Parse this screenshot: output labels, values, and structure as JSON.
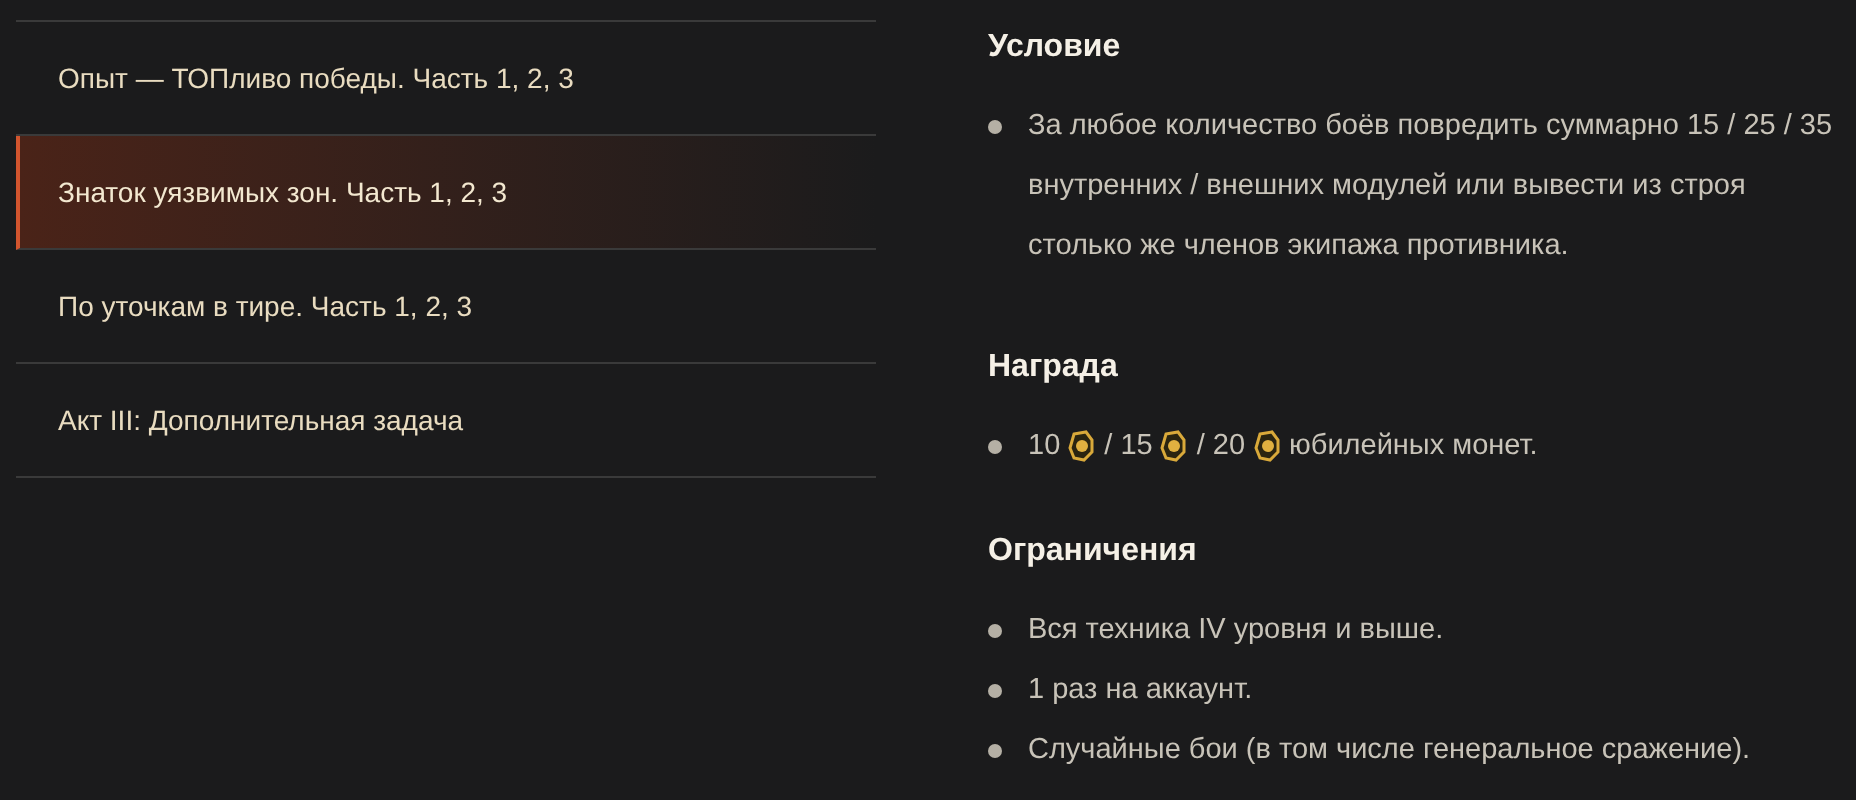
{
  "missions": [
    {
      "label": "Опыт — ТОПливо победы. Часть 1, 2, 3",
      "selected": false
    },
    {
      "label": "Знаток уязвимых зон. Часть 1, 2, 3",
      "selected": true
    },
    {
      "label": "По уточкам в тире. Часть 1, 2, 3",
      "selected": false
    },
    {
      "label": "Акт III: Дополнительная задача",
      "selected": false
    }
  ],
  "sections": [
    {
      "heading": "Условие",
      "items": [
        {
          "kind": "text",
          "text": "За любое количество боёв повредить суммарно 15 / 25 / 35 внутренних / внешних модулей или вывести из строя столько же членов экипажа противника."
        }
      ]
    },
    {
      "heading": "Награда",
      "items": [
        {
          "kind": "reward",
          "parts": [
            {
              "kind": "text",
              "text": "10"
            },
            {
              "kind": "coin"
            },
            {
              "kind": "text",
              "text": "/ 15"
            },
            {
              "kind": "coin"
            },
            {
              "kind": "text",
              "text": "/ 20"
            },
            {
              "kind": "coin"
            },
            {
              "kind": "text",
              "text": "юбилейных монет."
            }
          ]
        }
      ]
    },
    {
      "heading": "Ограничения",
      "items": [
        {
          "kind": "text",
          "text": "Вся техника IV уровня и выше."
        },
        {
          "kind": "text",
          "text": "1 раз на аккаунт."
        },
        {
          "kind": "text",
          "text": "Случайные бои (в том числе генеральное сражение)."
        }
      ]
    }
  ]
}
